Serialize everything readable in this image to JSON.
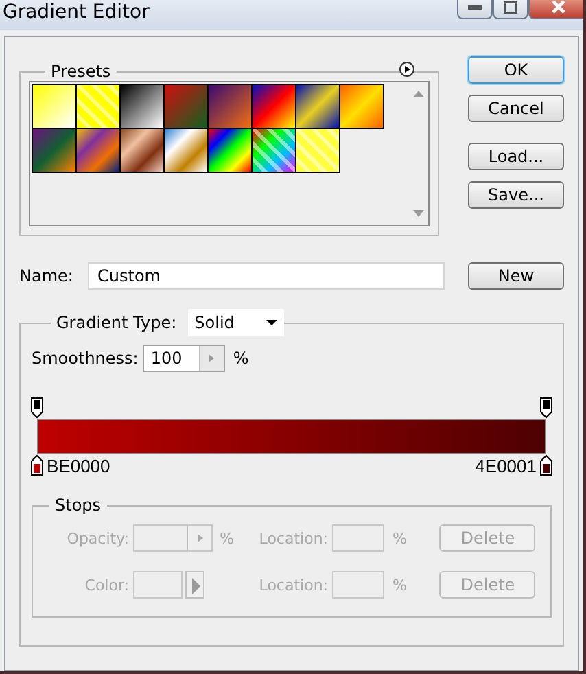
{
  "window": {
    "title": "Gradient Editor"
  },
  "presets": {
    "label": "Presets",
    "items": [
      {
        "kind": "solid"
      },
      {
        "kind": "fade"
      },
      {
        "kind": "solid"
      },
      {
        "kind": "solid"
      },
      {
        "kind": "solid"
      },
      {
        "kind": "solid"
      },
      {
        "kind": "solid"
      },
      {
        "kind": "solid"
      },
      {
        "kind": "solid"
      },
      {
        "kind": "solid"
      },
      {
        "kind": "solid"
      },
      {
        "kind": "solid"
      },
      {
        "kind": "solid"
      },
      {
        "kind": "fade"
      },
      {
        "kind": "fade"
      }
    ]
  },
  "buttons": [
    {
      "label": "OK",
      "default": true
    },
    {
      "label": "Cancel",
      "default": false
    },
    {
      "label": "Load...",
      "default": false
    },
    {
      "label": "Save...",
      "default": false
    }
  ],
  "name": {
    "label": "Name:",
    "value": "Custom",
    "button": "New"
  },
  "gradient": {
    "type_label": "Gradient Type:",
    "type": "Solid",
    "smoothness_label": "Smoothness:",
    "smoothness": "100",
    "unit": "%",
    "opacity_stops": [
      {
        "color": "#000000"
      },
      {
        "color": "#000000"
      }
    ],
    "color_stops": [
      {
        "color": "#be0000",
        "label": "BE0000"
      },
      {
        "color": "#4e0001",
        "label": "4E0001"
      }
    ]
  },
  "stops": {
    "label": "Stops",
    "disabled": true,
    "rows": [
      {
        "label": "Opacity:",
        "kind": "stepper",
        "unit": "%",
        "location_label": "Location:",
        "location_unit": "%",
        "button": "Delete"
      },
      {
        "label": "Color:",
        "kind": "swatch",
        "location_label": "Location:",
        "location_unit": "%",
        "button": "Delete"
      }
    ]
  }
}
